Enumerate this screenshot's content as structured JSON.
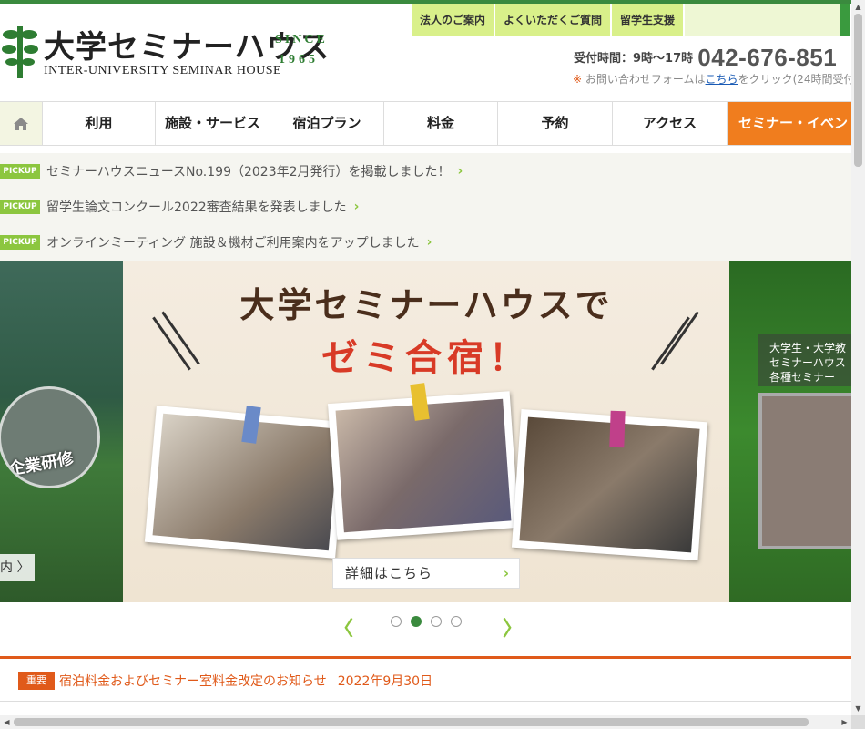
{
  "header": {
    "logo_title": "大学セミナーハウス",
    "logo_subtitle": "INTER-UNIVERSITY SEMINAR HOUSE",
    "logo_since": "SINCE",
    "logo_year": "1965",
    "top_links": [
      "法人のご案内",
      "よくいただくご質問",
      "留学生支援"
    ],
    "hours_label": "受付時間：9時〜17時",
    "phone": "042-676-851",
    "contact_mark": "※",
    "contact_prefix": "お問い合わせフォームは",
    "contact_link": "こちら",
    "contact_suffix": "をクリック(24時間受付"
  },
  "nav": {
    "home_icon": "home-icon",
    "items": [
      "利用",
      "施設・サービス",
      "宿泊プラン",
      "料金",
      "予約",
      "アクセス",
      "セミナー・イベン"
    ]
  },
  "pickups": [
    {
      "badge": "PICKUP",
      "text": "セミナーハウスニュースNo.199（2023年2月発行）を掲載しました！"
    },
    {
      "badge": "PICKUP",
      "text": "留学生論文コンクール2022審査結果を発表しました"
    },
    {
      "badge": "PICKUP",
      "text": "オンラインミーティング 施設＆機材ご利用案内をアップしました"
    }
  ],
  "slider": {
    "left_caption": "企業研修",
    "left_tag": "内 〉",
    "headline1": "大学セミナーハウスで",
    "headline2": "ゼミ合宿！",
    "detail_button": "詳細はこちら",
    "right_text": [
      "大学生・大学教",
      "セミナーハウス",
      "各種セミナー"
    ],
    "dots": 4,
    "active_dot": 1,
    "prev_arrow": "〈",
    "next_arrow": "〉"
  },
  "notice": {
    "badge": "重要",
    "text": "宿泊料金およびセミナー室料金改定のお知らせ",
    "date": "2022年9月30日"
  },
  "colors": {
    "brand_green": "#3a8a3e",
    "pickup_green": "#8cc63f",
    "accent_orange": "#f07d1e",
    "notice_red": "#e05a1a"
  }
}
